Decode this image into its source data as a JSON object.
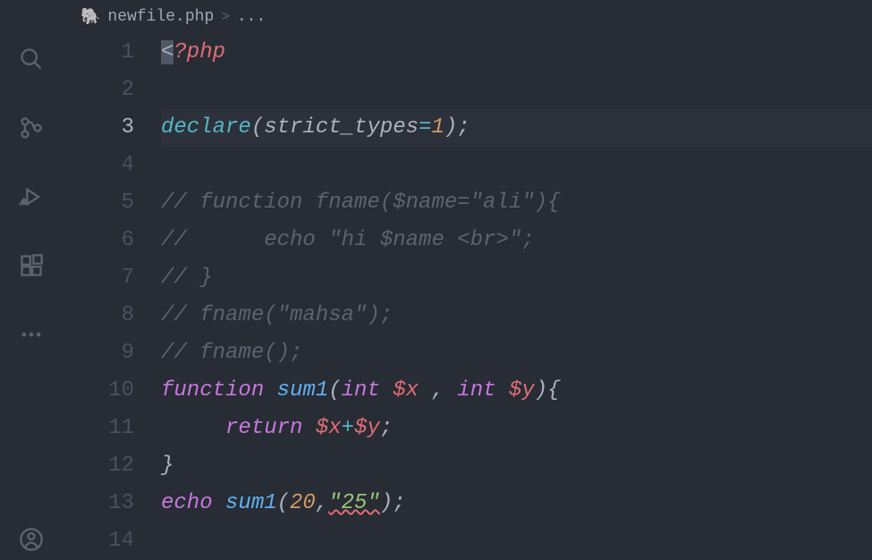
{
  "breadcrumb": {
    "icon": "🐘",
    "filename": "newfile.php",
    "chevron": ">",
    "rest": "..."
  },
  "activeLine": 3,
  "lines": [
    {
      "num": 1,
      "tokens": [
        {
          "cls": "cursor-sel",
          "text": "<"
        },
        {
          "cls": "tk-php-open",
          "text": "?php"
        }
      ]
    },
    {
      "num": 2,
      "tokens": []
    },
    {
      "num": 3,
      "active": true,
      "tokens": [
        {
          "cls": "tk-func-call",
          "text": "declare"
        },
        {
          "cls": "tk-punct",
          "text": "("
        },
        {
          "cls": "tk-plain",
          "text": "strict_types"
        },
        {
          "cls": "tk-operator",
          "text": "="
        },
        {
          "cls": "tk-number",
          "text": "1"
        },
        {
          "cls": "tk-punct",
          "text": ");"
        }
      ]
    },
    {
      "num": 4,
      "tokens": []
    },
    {
      "num": 5,
      "tokens": [
        {
          "cls": "tk-comment",
          "text": "// function fname($name=\"ali\"){"
        }
      ]
    },
    {
      "num": 6,
      "tokens": [
        {
          "cls": "tk-comment",
          "text": "//      echo \"hi $name <br>\";"
        }
      ]
    },
    {
      "num": 7,
      "tokens": [
        {
          "cls": "tk-comment",
          "text": "// }"
        }
      ]
    },
    {
      "num": 8,
      "tokens": [
        {
          "cls": "tk-comment",
          "text": "// fname(\"mahsa\");"
        }
      ]
    },
    {
      "num": 9,
      "tokens": [
        {
          "cls": "tk-comment",
          "text": "// fname();"
        }
      ]
    },
    {
      "num": 10,
      "tokens": [
        {
          "cls": "tk-func-decl",
          "text": "function"
        },
        {
          "cls": "tk-plain",
          "text": " "
        },
        {
          "cls": "tk-func-name",
          "text": "sum1"
        },
        {
          "cls": "tk-punct",
          "text": "("
        },
        {
          "cls": "tk-type",
          "text": "int"
        },
        {
          "cls": "tk-plain",
          "text": " "
        },
        {
          "cls": "tk-var",
          "text": "$x"
        },
        {
          "cls": "tk-plain",
          "text": " "
        },
        {
          "cls": "tk-punct",
          "text": ","
        },
        {
          "cls": "tk-plain",
          "text": " "
        },
        {
          "cls": "tk-type",
          "text": "int"
        },
        {
          "cls": "tk-plain",
          "text": " "
        },
        {
          "cls": "tk-var",
          "text": "$y"
        },
        {
          "cls": "tk-punct",
          "text": "){"
        }
      ]
    },
    {
      "num": 11,
      "tokens": [
        {
          "cls": "tk-plain",
          "text": "     "
        },
        {
          "cls": "tk-return",
          "text": "return"
        },
        {
          "cls": "tk-plain",
          "text": " "
        },
        {
          "cls": "tk-var",
          "text": "$x"
        },
        {
          "cls": "tk-operator",
          "text": "+"
        },
        {
          "cls": "tk-var",
          "text": "$y"
        },
        {
          "cls": "tk-punct",
          "text": ";"
        }
      ]
    },
    {
      "num": 12,
      "tokens": [
        {
          "cls": "tk-punct",
          "text": "}"
        }
      ]
    },
    {
      "num": 13,
      "tokens": [
        {
          "cls": "tk-echo",
          "text": "echo"
        },
        {
          "cls": "tk-plain",
          "text": " "
        },
        {
          "cls": "tk-func-name",
          "text": "sum1"
        },
        {
          "cls": "tk-punct",
          "text": "("
        },
        {
          "cls": "tk-number",
          "text": "20"
        },
        {
          "cls": "tk-punct",
          "text": ","
        },
        {
          "cls": "tk-string error-underline",
          "text": "\"25\""
        },
        {
          "cls": "tk-punct",
          "text": ");"
        }
      ]
    },
    {
      "num": 14,
      "tokens": []
    }
  ]
}
